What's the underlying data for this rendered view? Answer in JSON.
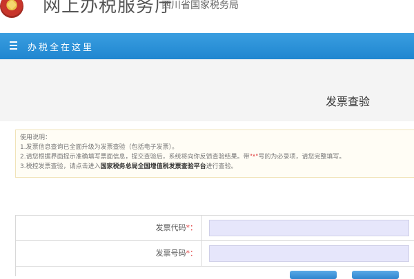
{
  "header": {
    "site_title": "网上办税服务厅",
    "site_subtitle": "西川省国家税务局"
  },
  "navbar": {
    "label": "办税全在这里"
  },
  "page": {
    "title": "发票查验"
  },
  "instructions": {
    "heading": "使用说明：",
    "line1": "1.发票信息查询已全面升级为发票查验（包括电子发票）。",
    "line2_before": "2.请您根据界面提示准确填写票面信息，提交查验后，系统将向你反馈查验结果。带",
    "line2_mark": "\"*\"",
    "line2_after": "号的为必录项，请您完整填写。",
    "line3_before": "3.税控发票查验，请点击进入",
    "line3_link": "国家税务总局全国增值税发票查验平台",
    "line3_after": "进行查验。"
  },
  "form": {
    "fields": [
      {
        "label": "发票代码",
        "required_mark": "*：",
        "value": "",
        "placeholder": ""
      },
      {
        "label": "发票号码",
        "required_mark": "*：",
        "value": "",
        "placeholder": ""
      }
    ]
  },
  "colors": {
    "navbar": "#1f86d0",
    "input_bg": "#e6e6fb",
    "notice_bg": "#fffdf5",
    "required": "#e04040"
  }
}
